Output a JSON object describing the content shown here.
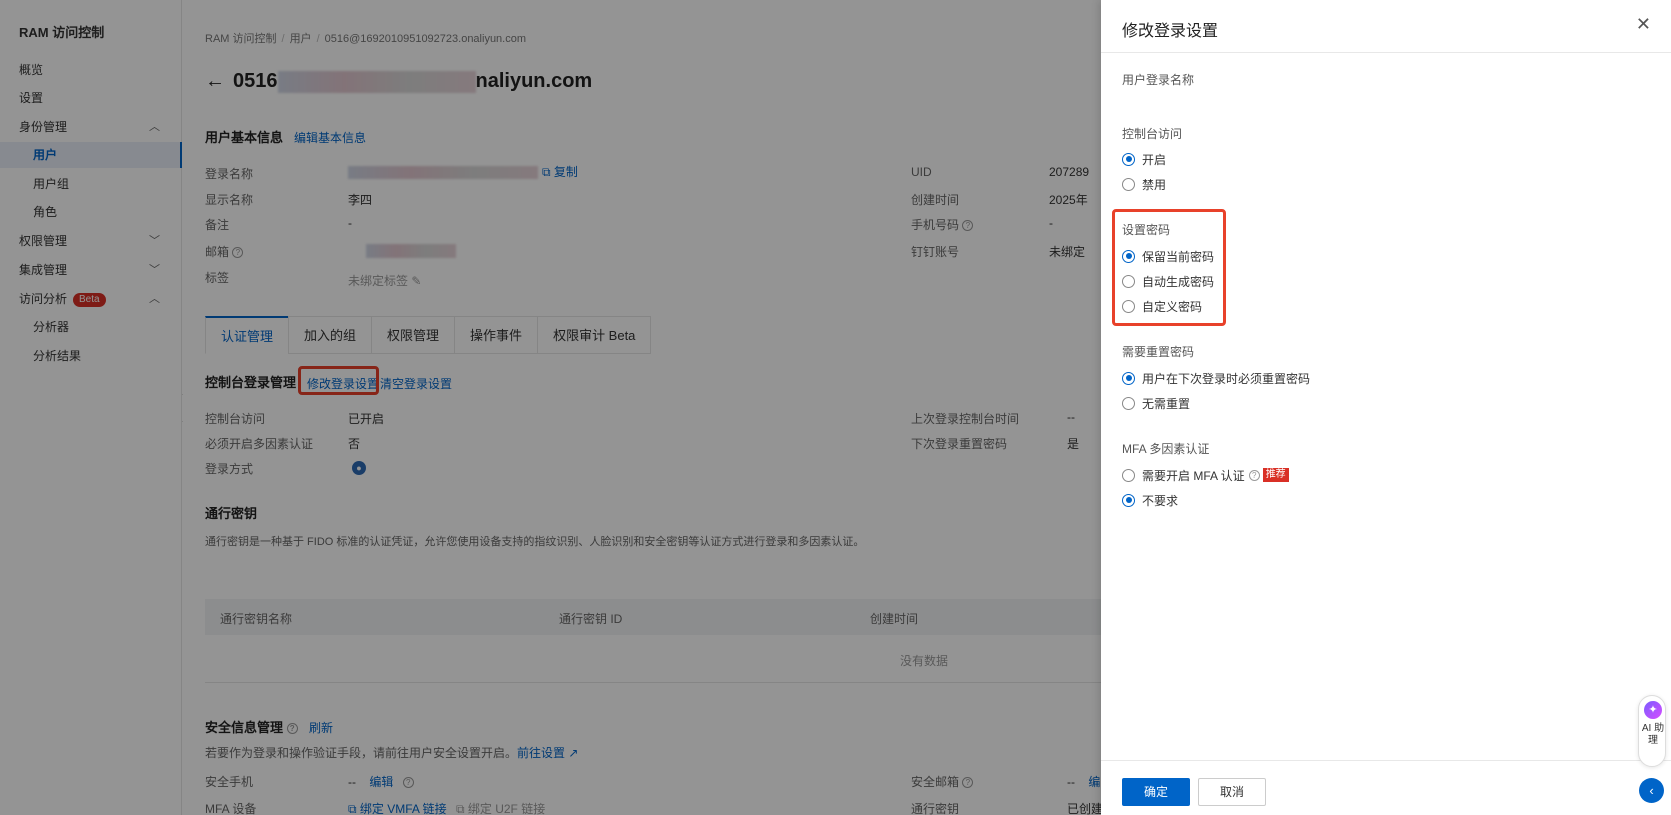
{
  "sidebar": {
    "title": "RAM 访问控制",
    "items": [
      {
        "label": "概览"
      },
      {
        "label": "设置"
      },
      {
        "label": "身份管理",
        "chevron": "^"
      },
      {
        "label": "用户"
      },
      {
        "label": "用户组"
      },
      {
        "label": "角色"
      },
      {
        "label": "权限管理",
        "chevron": "v"
      },
      {
        "label": "集成管理",
        "chevron": "v"
      },
      {
        "label": "访问分析",
        "chevron": "^",
        "badge": "Beta"
      },
      {
        "label": "分析器"
      },
      {
        "label": "分析结果"
      }
    ]
  },
  "breadcrumb": [
    "RAM 访问控制",
    "用户",
    "0516@1692010951092723.onaliyun.com"
  ],
  "page_title": {
    "prefix": "0516",
    "suffix": "naliyun.com"
  },
  "basic_info": {
    "title": "用户基本信息",
    "edit_link": "编辑基本信息",
    "fields": [
      {
        "label": "登录名称",
        "value": "",
        "action": "复制"
      },
      {
        "label": "显示名称",
        "value": "李四"
      },
      {
        "label": "备注",
        "value": "-"
      },
      {
        "label": "邮箱",
        "value": ""
      },
      {
        "label": "标签",
        "value": "未绑定标签"
      }
    ],
    "right_fields": [
      {
        "label": "UID",
        "value": "207289"
      },
      {
        "label": "创建时间",
        "value": "2025年"
      },
      {
        "label": "手机号码",
        "value": "-"
      },
      {
        "label": "钉钉账号",
        "value": "未绑定"
      }
    ]
  },
  "tabs": [
    "认证管理",
    "加入的组",
    "权限管理",
    "操作事件",
    "权限审计 Beta"
  ],
  "console_login": {
    "title": "控制台登录管理",
    "modify_link": "修改登录设置",
    "clear_link": "清空登录设置",
    "fields": [
      {
        "label": "控制台访问",
        "value": "已开启"
      },
      {
        "label": "必须开启多因素认证",
        "value": "否"
      },
      {
        "label": "登录方式",
        "value": ""
      }
    ],
    "right_fields": [
      {
        "label": "上次登录控制台时间",
        "value": "--"
      },
      {
        "label": "下次登录重置密码",
        "value": "是"
      }
    ]
  },
  "passkey": {
    "title": "通行密钥",
    "description": "通行密钥是一种基于 FIDO 标准的认证凭证，允许您使用设备支持的指纹识别、人脸识别和安全密钥等认证方式进行登录和多因素认证。",
    "columns": [
      "通行密钥名称",
      "通行密钥 ID",
      "创建时间"
    ],
    "empty_text": "没有数据"
  },
  "security": {
    "title": "安全信息管理",
    "refresh_link": "刷新",
    "description": "若要作为登录和操作验证手段，请前往用户安全设置开启。",
    "goto_link": "前往设置",
    "rows": [
      {
        "label": "安全手机",
        "value": "--",
        "action": "编辑"
      },
      {
        "label": "MFA 设备",
        "action1": "绑定 VMFA 链接",
        "action2": "绑定 U2F 链接"
      }
    ],
    "right_rows": [
      {
        "label": "安全邮箱",
        "value": "--",
        "action": "编"
      },
      {
        "label": "通行密钥",
        "value": "已创建"
      }
    ]
  },
  "drawer": {
    "title": "修改登录设置",
    "login_name_label": "用户登录名称",
    "console_access": {
      "label": "控制台访问",
      "options": [
        "开启",
        "禁用"
      ],
      "selected": 0
    },
    "set_password": {
      "label": "设置密码",
      "options": [
        "保留当前密码",
        "自动生成密码",
        "自定义密码"
      ],
      "selected": 0
    },
    "reset_password": {
      "label": "需要重置密码",
      "options": [
        "用户在下次登录时必须重置密码",
        "无需重置"
      ],
      "selected": 0
    },
    "mfa": {
      "label": "MFA 多因素认证",
      "options": [
        "需要开启 MFA 认证",
        "不要求"
      ],
      "recommend_badge": "推荐",
      "selected": 1
    },
    "confirm_label": "确定",
    "cancel_label": "取消"
  },
  "ai_assistant": {
    "label": "AI 助理"
  },
  "colors": {
    "primary": "#0064c8",
    "highlight": "#e8412a",
    "badge": "#d93026"
  }
}
